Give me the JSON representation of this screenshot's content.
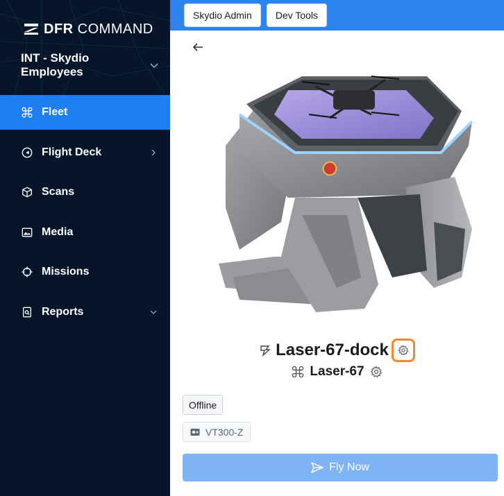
{
  "app": {
    "logo_text_bold": "DFR",
    "logo_text_light": " COMMAND",
    "org_name": "INT - Skydio Employees"
  },
  "nav": {
    "items": [
      {
        "label": "Fleet",
        "icon": "drone-icon",
        "active": true
      },
      {
        "label": "Flight Deck",
        "icon": "compass-icon"
      },
      {
        "label": "Scans",
        "icon": "cube-icon"
      },
      {
        "label": "Media",
        "icon": "image-icon"
      },
      {
        "label": "Missions",
        "icon": "crosshair-icon"
      },
      {
        "label": "Reports",
        "icon": "report-icon"
      }
    ]
  },
  "topbar": {
    "admin_label": "Skydio Admin",
    "devtools_label": "Dev Tools"
  },
  "device": {
    "dock_name": "Laser-67-dock",
    "drone_name": "Laser-67",
    "status": "Offline",
    "model": "VT300-Z"
  },
  "actions": {
    "fly_now_label": "Fly Now"
  },
  "colors": {
    "sidebar_bg": "#061529",
    "accent": "#1f7ff0",
    "topbar": "#2b83f0",
    "highlight": "#ef8a2c",
    "fly_button": "#7fb4f4"
  }
}
